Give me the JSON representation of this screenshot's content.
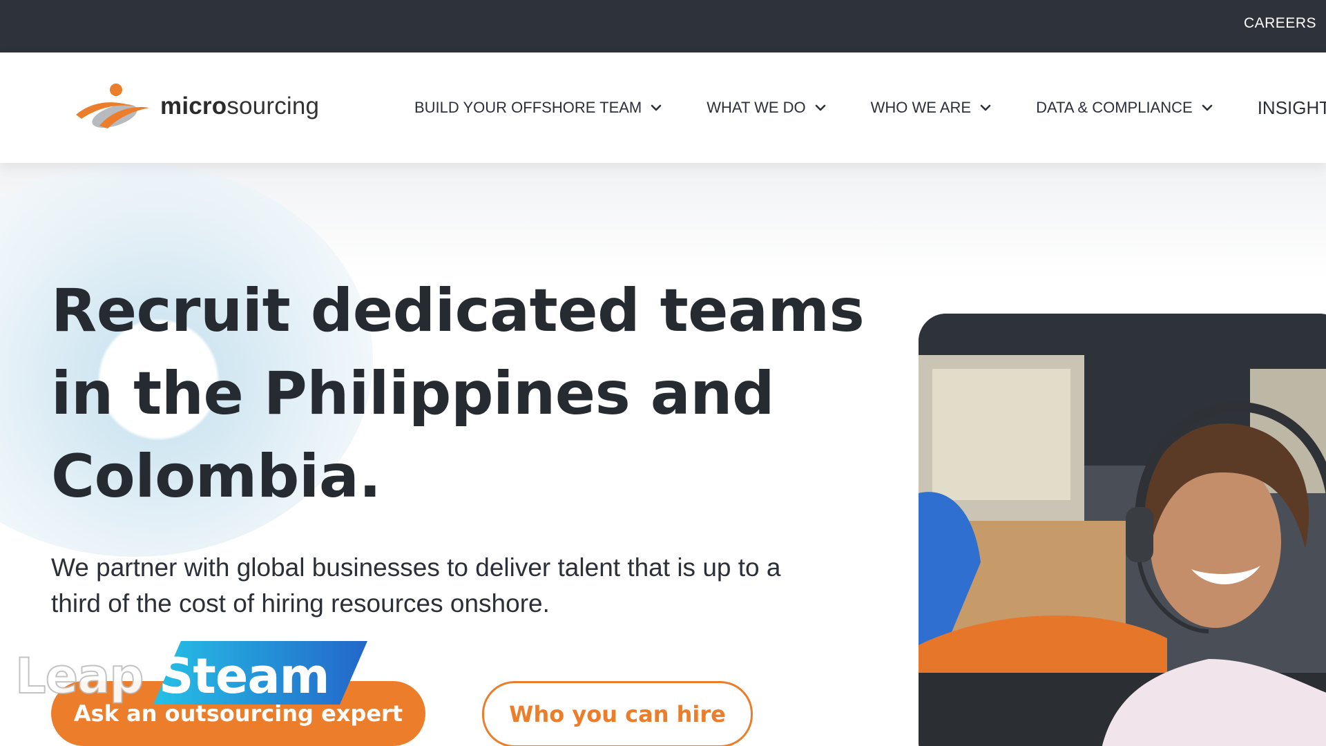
{
  "topbar": {
    "careers_label": "CAREERS"
  },
  "logo": {
    "text_bold": "micro",
    "text_regular": "sourcing",
    "colors": {
      "orange": "#ec7d2a",
      "gray": "#9a9ea4"
    }
  },
  "nav": {
    "items": [
      {
        "label": "BUILD YOUR OFFSHORE TEAM",
        "icon": "chevron-down-icon"
      },
      {
        "label": "WHAT WE DO",
        "icon": "chevron-down-icon"
      },
      {
        "label": "WHO WE ARE",
        "icon": "chevron-down-icon"
      },
      {
        "label": "DATA & COMPLIANCE",
        "icon": "chevron-down-icon"
      },
      {
        "label": "INSIGHTS"
      }
    ]
  },
  "hero": {
    "headline_lines": [
      "Recruit dedicated teams",
      "in the Philippines and",
      "Colombia."
    ],
    "subheading_lines": [
      "We partner with global businesses to deliver talent that is up to a",
      "third of the cost of hiring resources onshore."
    ],
    "primary_button": "Ask an outsourcing expert",
    "secondary_button": "Who you can hire",
    "accent_color": "#ec7d2a"
  },
  "watermark": {
    "word1": "Leap",
    "word2": "Steam"
  }
}
